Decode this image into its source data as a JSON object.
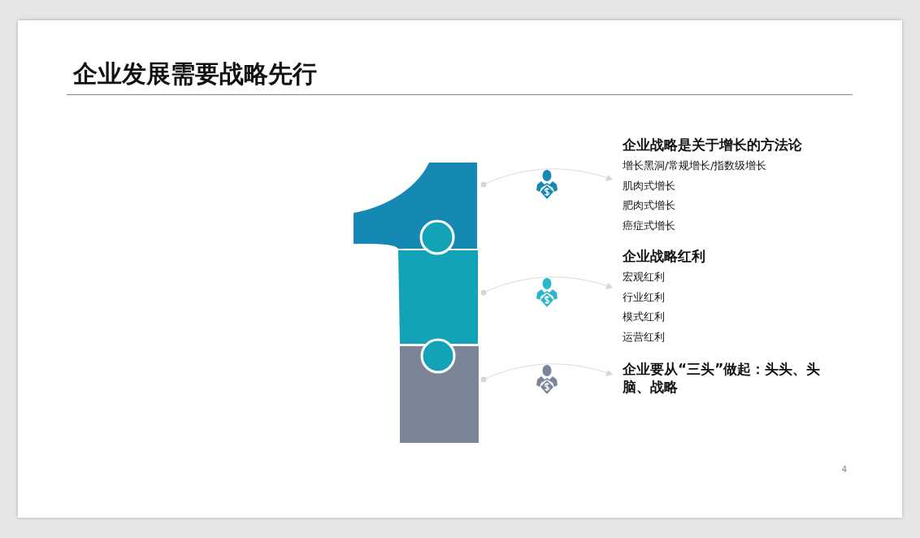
{
  "slide": {
    "title": "企业发展需要战略先行",
    "page_number": "4",
    "sections": [
      {
        "heading": "企业战略是关于增长的方法论",
        "color": "#1589b4",
        "items": [
          "增长黑洞/常规增长/指数级增长",
          "肌肉式增长",
          "肥肉式增长",
          "癌症式增长"
        ]
      },
      {
        "heading": "企业战略红利",
        "color": "#2bb6cc",
        "items": [
          "宏观红利",
          "行业红利",
          "模式红利",
          "运营红利"
        ]
      },
      {
        "heading": "企业要从“三头”做起：头头、头脑、战略",
        "color": "#7a8597"
      }
    ]
  }
}
